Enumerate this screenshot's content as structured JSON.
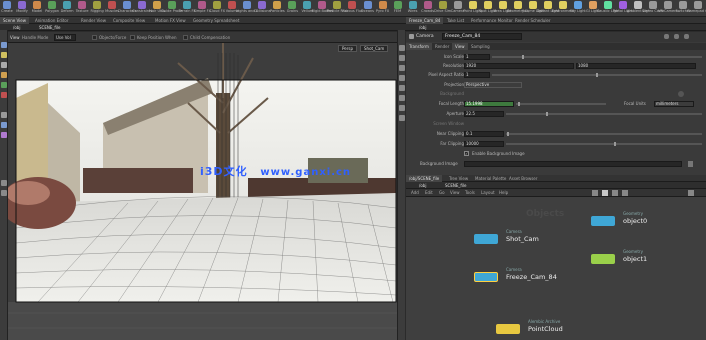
{
  "shelf": {
    "tools": [
      {
        "label": "Create",
        "color": "#6a8fd0"
      },
      {
        "label": "Modify",
        "color": "#8a6ad0"
      },
      {
        "label": "Model",
        "color": "#d08a4a"
      },
      {
        "label": "Polygon",
        "color": "#5aa05a"
      },
      {
        "label": "Deform",
        "color": "#4aa0b0"
      },
      {
        "label": "Texture",
        "color": "#b05a8a"
      },
      {
        "label": "Rigging",
        "color": "#a0a040"
      },
      {
        "label": "Muscles",
        "color": "#c05050"
      },
      {
        "label": "Characters",
        "color": "#6a8fd0"
      },
      {
        "label": "Constraints",
        "color": "#8a6ad0"
      },
      {
        "label": "Hair Utils",
        "color": "#d0a04a"
      },
      {
        "label": "Guide Process",
        "color": "#5aa05a"
      },
      {
        "label": "Terrain FX",
        "color": "#4aa0b0"
      },
      {
        "label": "Simple FX",
        "color": "#b05a8a"
      },
      {
        "label": "Cloud FX",
        "color": "#a0a040"
      },
      {
        "label": "Volume",
        "color": "#c05050"
      },
      {
        "label": "Lights and Cameras",
        "color": "#6a8fd0"
      },
      {
        "label": "Collisions",
        "color": "#8a6ad0"
      },
      {
        "label": "Particles",
        "color": "#d0a04a"
      },
      {
        "label": "Grains",
        "color": "#5aa05a"
      },
      {
        "label": "Vellum",
        "color": "#4aa0b0"
      },
      {
        "label": "Rigid Bodies",
        "color": "#b05a8a"
      },
      {
        "label": "Particle Fluids",
        "color": "#a0a040"
      },
      {
        "label": "Viscous Fluids",
        "color": "#c05050"
      },
      {
        "label": "Oceans",
        "color": "#6a8fd0"
      },
      {
        "label": "Pyro FX",
        "color": "#d08a4a"
      },
      {
        "label": "FEM",
        "color": "#5aa05a"
      },
      {
        "label": "Wires",
        "color": "#4aa0b0"
      },
      {
        "label": "Crowds",
        "color": "#b05a8a"
      },
      {
        "label": "Drive Sim",
        "color": "#a0a040"
      },
      {
        "label": "Camera",
        "color": "#9a9a9a"
      },
      {
        "label": "Point Light",
        "color": "#e0d060"
      },
      {
        "label": "Spot Light",
        "color": "#e0d060"
      },
      {
        "label": "Area Light",
        "color": "#e0d060"
      },
      {
        "label": "Geometry Light",
        "color": "#e0d060"
      },
      {
        "label": "Volume Light",
        "color": "#e0d060"
      },
      {
        "label": "Distant Light",
        "color": "#e0d060"
      },
      {
        "label": "Environment Light",
        "color": "#e0d060"
      },
      {
        "label": "Sky Light",
        "color": "#60a0e0"
      },
      {
        "label": "GI Light",
        "color": "#e0a060"
      },
      {
        "label": "Caustic Light",
        "color": "#60e0a0"
      },
      {
        "label": "Portal Light",
        "color": "#a060e0"
      },
      {
        "label": "Ambient Light",
        "color": "#c0c0c0"
      },
      {
        "label": "Stereo Camera",
        "color": "#9a9a9a"
      },
      {
        "label": "VR Camera",
        "color": "#9a9a9a"
      },
      {
        "label": "Switcher",
        "color": "#9a9a9a"
      },
      {
        "label": "Gamepad Camera",
        "color": "#9a9a9a"
      }
    ]
  },
  "left_panel": {
    "tabs": [
      "Scene View",
      "Animation Editor",
      "Render View",
      "Composite View",
      "Motion FX View",
      "Geometry Spreadsheet"
    ],
    "path_tab": "/obj",
    "context": "SCENE_file",
    "view_label": "View",
    "viewport_toolbar": {
      "handle_label": "Handle Mode",
      "pivot": "Use Vol",
      "items": [
        "Objects/Force",
        "Keep Position When",
        "Child Compensation"
      ]
    },
    "camera_menu": "Persp",
    "cam_menu2": "Shot_Cam"
  },
  "watermark": {
    "prefix": "i",
    "brand": "3D文化",
    "url": "www.ganxi.cn"
  },
  "right_top": {
    "tabs": [
      "Freeze_Cam_84",
      "Take List",
      "Performance Monitor",
      "Render Scheduler"
    ],
    "path": "/obj",
    "node_type": "Camera",
    "node_name": "Freeze_Cam_84",
    "sub_tabs": [
      "Transform",
      "Render",
      "View",
      "Sampling"
    ],
    "params": [
      {
        "label": "Icon Scale",
        "value": "1"
      },
      {
        "label": "Resolution",
        "value": "1920",
        "value2": "1080"
      },
      {
        "label": "Pixel Aspect Ratio",
        "value": "1"
      },
      {
        "label": "Projection",
        "value": "Perspective"
      },
      {
        "label": "Background",
        "value": ""
      },
      {
        "label": "Focal Length",
        "value": "15.1998",
        "extra_label": "Focal Units",
        "extra_value": "millimeters"
      },
      {
        "label": "Aperture",
        "value": "22.5"
      },
      {
        "label": "Screen Window",
        "value": ""
      },
      {
        "label": "Near Clipping",
        "value": "0.1"
      },
      {
        "label": "Far Clipping",
        "value": "10000"
      },
      {
        "label": "Enable Background Image",
        "value": ""
      },
      {
        "label": "Background Image",
        "value": ""
      }
    ]
  },
  "network": {
    "tabs": [
      "/obj/SCENE_file",
      "Tree View",
      "Material Palette",
      "Asset Browser"
    ],
    "path": "/obj",
    "context": "SCENE_file",
    "menu": [
      "Add",
      "Edit",
      "Go",
      "View",
      "Tools",
      "Layout",
      "Help"
    ],
    "context_title": "Objects",
    "nodes": [
      {
        "type": "Camera",
        "name": "Shot_Cam",
        "color": "#3fa7d6"
      },
      {
        "type": "Camera",
        "name": "Freeze_Cam_84",
        "color": "#3fa7d6"
      },
      {
        "type": "Geometry",
        "name": "object0",
        "color": "#3fa7d6"
      },
      {
        "type": "Geometry",
        "name": "object1",
        "color": "#9ad04a"
      },
      {
        "type": "Alembic Archive",
        "name": "PointCloud",
        "color": "#e8c840"
      }
    ]
  }
}
